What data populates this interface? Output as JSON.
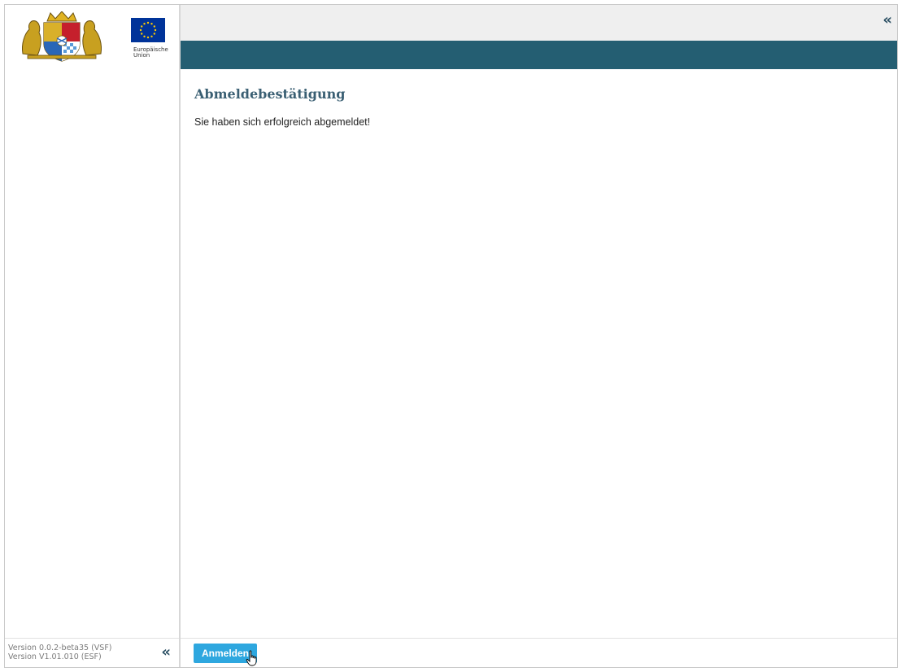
{
  "sidebar": {
    "eu_label": [
      "Europäische",
      "Union"
    ],
    "version_vsf": "Version 0.0.2-beta35 (VSF)",
    "version_esf": "Version V1.01.010 (ESF)",
    "collapse_icon": "«"
  },
  "header": {
    "collapse_icon": "«"
  },
  "main": {
    "title": "Abmeldebestätigung",
    "message": "Sie haben sich erfolgreich abgemeldet!"
  },
  "footer": {
    "login_label": "Anmelden"
  },
  "colors": {
    "header_bar": "#245e72",
    "accent_button": "#2ea7df",
    "title": "#3a5f73",
    "eu_blue": "#003399",
    "eu_gold": "#ffcc00"
  },
  "icons": {
    "crest": "bavarian-coat-of-arms-icon",
    "eu_flag": "eu-flag-icon",
    "collapse": "double-chevron-left-icon",
    "pointer": "hand-pointer-cursor-icon"
  }
}
